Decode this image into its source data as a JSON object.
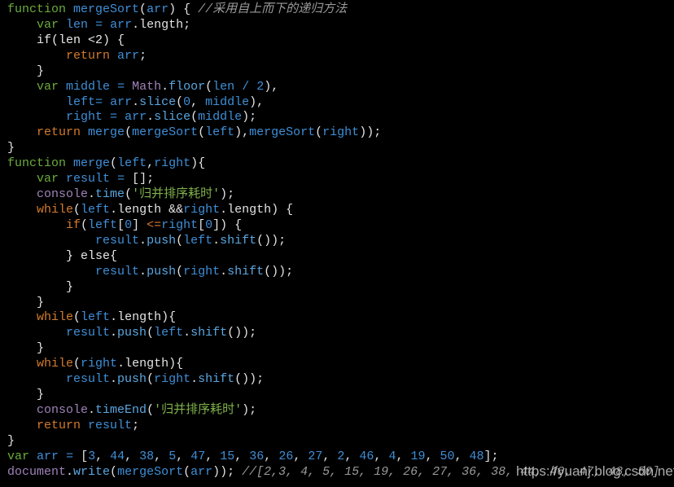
{
  "editor": {
    "language": "javascript",
    "theme_colors": {
      "background": "#000000",
      "keyword": "#6bab3b",
      "control": "#d37a2c",
      "identifier": "#3e8fd8",
      "string": "#7fb24a",
      "comment": "#9a9a9a"
    },
    "lines": [
      "function mergeSort(arr) { //采用自上而下的递归方法",
      "    var len = arr.length;",
      "    if(len <2) {",
      "        return arr;",
      "    }",
      "    var middle = Math.floor(len / 2),",
      "        left= arr.slice(0, middle),",
      "        right = arr.slice(middle);",
      "    return merge(mergeSort(left),mergeSort(right));",
      "}",
      "function merge(left,right){",
      "    var result = [];",
      "    console.time('归并排序耗时');",
      "    while(left.length &&right.length) {",
      "        if(left[0] <=right[0]) {",
      "            result.push(left.shift());",
      "        } else{",
      "            result.push(right.shift());",
      "        }",
      "    }",
      "    while(left.length){",
      "        result.push(left.shift());",
      "    }",
      "    while(right.length){",
      "        result.push(right.shift());",
      "    }",
      "    console.timeEnd('归并排序耗时');",
      "    return result;",
      "}",
      "var arr = [3, 44, 38, 5, 47, 15, 36, 26, 27, 2, 46, 4, 19, 50, 48];",
      "document.write(mergeSort(arr)); //[2,3, 4, 5, 15, 19, 26, 27, 36, 38, 44, 46, 47, 48, 50]"
    ]
  },
  "watermark": "https://yuanj.blog.csdn.net"
}
